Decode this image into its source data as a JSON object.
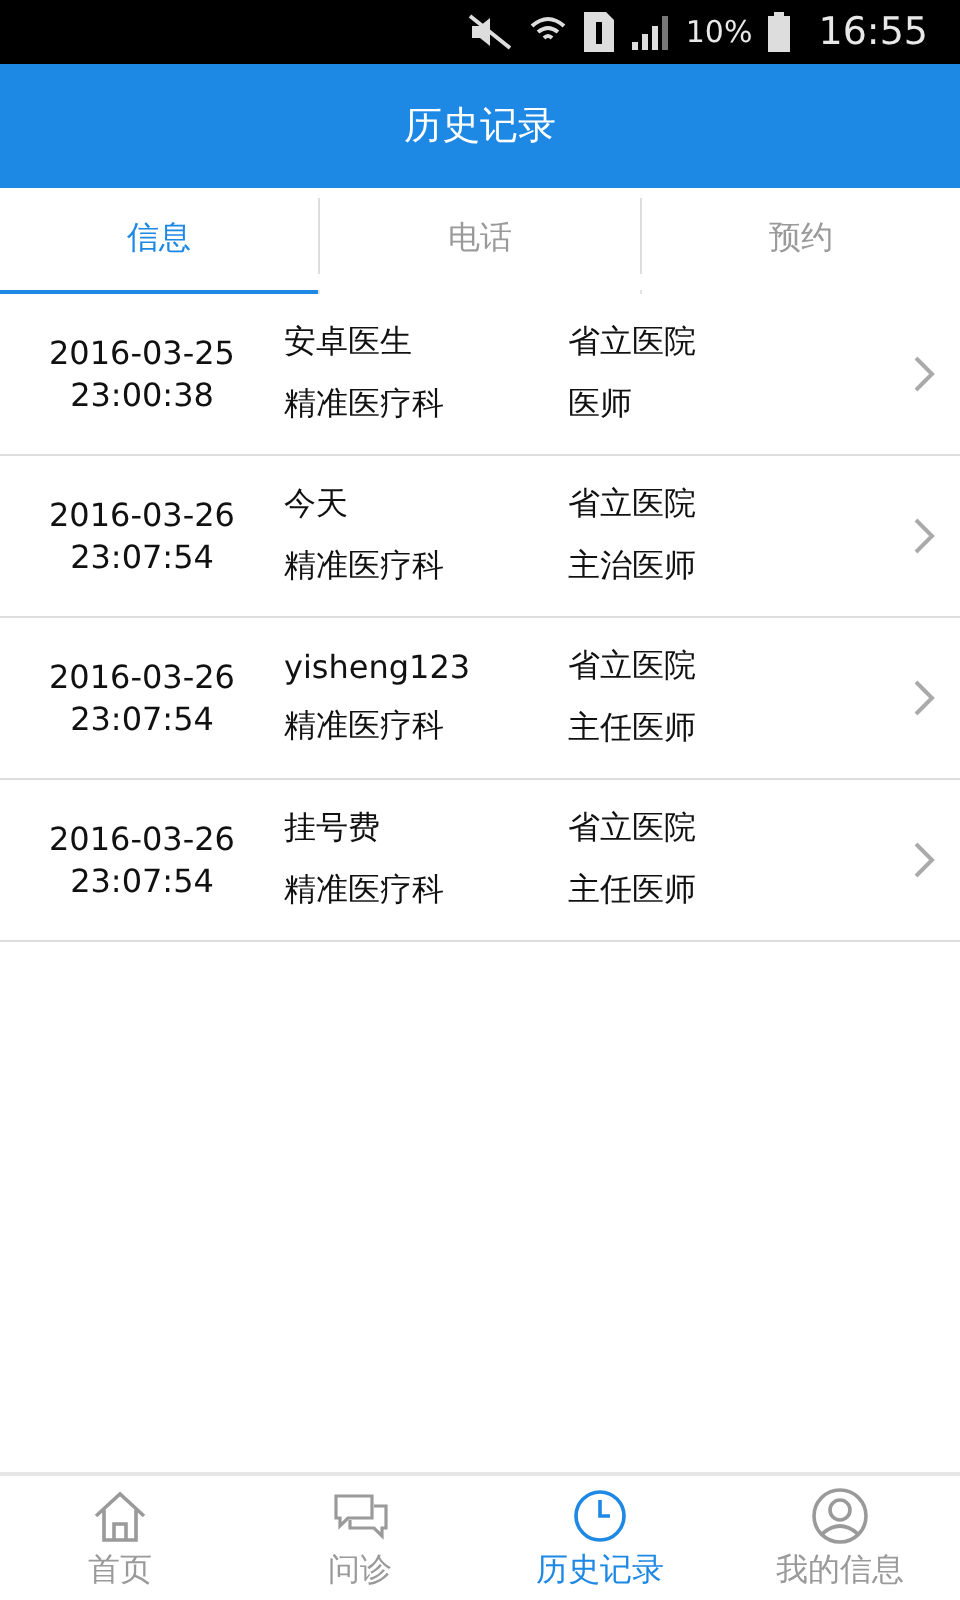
{
  "status_bar": {
    "battery": "10%",
    "time": "16:55"
  },
  "header": {
    "title": "历史记录"
  },
  "tabs": [
    {
      "label": "信息",
      "selected": true
    },
    {
      "label": "电话",
      "selected": false
    },
    {
      "label": "预约",
      "selected": false
    }
  ],
  "records": [
    {
      "date": "2016-03-25",
      "time": "23:00:38",
      "name": "安卓医生",
      "department": "精准医疗科",
      "hospital": "省立医院",
      "title": "医师"
    },
    {
      "date": "2016-03-26",
      "time": "23:07:54",
      "name": "今天",
      "department": "精准医疗科",
      "hospital": "省立医院",
      "title": "主治医师"
    },
    {
      "date": "2016-03-26",
      "time": "23:07:54",
      "name": "yisheng123",
      "department": "精准医疗科",
      "hospital": "省立医院",
      "title": "主任医师"
    },
    {
      "date": "2016-03-26",
      "time": "23:07:54",
      "name": "挂号费",
      "department": "精准医疗科",
      "hospital": "省立医院",
      "title": "主任医师"
    }
  ],
  "nav": [
    {
      "label": "首页",
      "kind": "home",
      "selected": false
    },
    {
      "label": "问诊",
      "kind": "chat",
      "selected": false
    },
    {
      "label": "历史记录",
      "kind": "clock",
      "selected": true
    },
    {
      "label": "我的信息",
      "kind": "person",
      "selected": false
    }
  ]
}
